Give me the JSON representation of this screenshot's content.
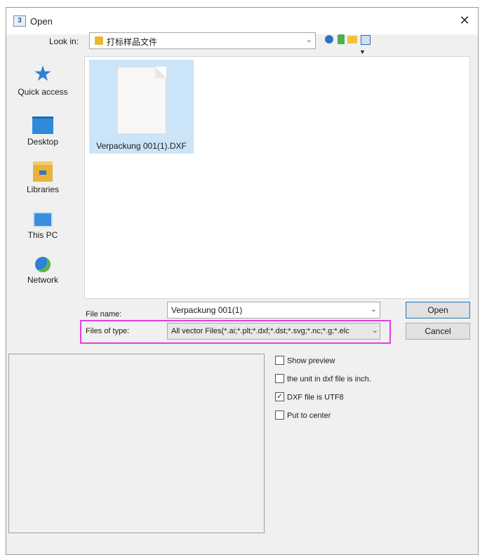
{
  "window": {
    "title": "Open",
    "app_icon_text": "3",
    "close": "✕"
  },
  "lookin": {
    "label": "Look in:",
    "value": "打标样品文件"
  },
  "places": [
    {
      "label": "Quick access",
      "icon": "star-icon"
    },
    {
      "label": "Desktop",
      "icon": "desktop-icon"
    },
    {
      "label": "Libraries",
      "icon": "libraries-icon"
    },
    {
      "label": "This PC",
      "icon": "computer-icon"
    },
    {
      "label": "Network",
      "icon": "network-icon"
    }
  ],
  "files": [
    {
      "name": "Verpackung 001(1).DXF",
      "selected": true
    }
  ],
  "filename": {
    "label": "File name:",
    "value": "Verpackung 001(1)"
  },
  "filetype": {
    "label": "Files of type:",
    "value": "All vector Files(*.ai;*.plt;*.dxf;*.dst;*.svg;*.nc;*.g;*.elc"
  },
  "buttons": {
    "open": "Open",
    "cancel": "Cancel"
  },
  "options": [
    {
      "label": "Show preview",
      "checked": false
    },
    {
      "label": "the unit in dxf file is inch.",
      "checked": false
    },
    {
      "label": "DXF file is UTF8",
      "checked": true
    },
    {
      "label": "Put to center",
      "checked": false
    }
  ],
  "colors": {
    "highlight": "#e040e0",
    "selection": "#cce4f7",
    "accent": "#2f7fd8"
  }
}
